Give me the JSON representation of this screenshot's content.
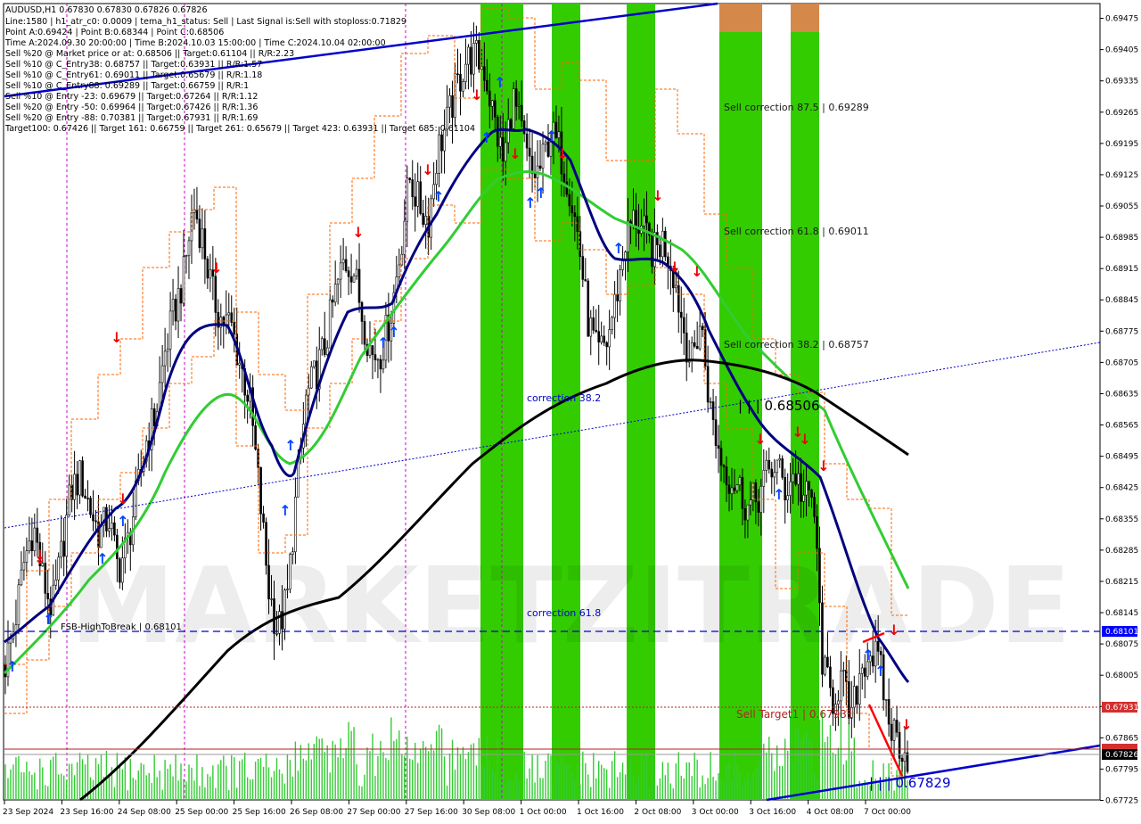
{
  "header": {
    "symbol_line": "AUDUSD,H1  0.67830 0.67830 0.67826 0.67826",
    "info_lines": [
      "Line:1580 | h1_atr_c0: 0.0009 | tema_h1_status: Sell | Last Signal is:Sell with stoploss:0.71829",
      "Point A:0.69424 | Point B:0.68344 | Point C:0.68506",
      "Time A:2024.09.30 20:00:00 | Time B:2024.10.03 15:00:00 | Time C:2024.10.04 02:00:00",
      "Sell %20 @ Market price or at: 0.68506 || Target:0.61104 || R/R:2.23",
      "Sell %10 @ C_Entry38: 0.68757 || Target:0.63931 || R/R:1.57",
      "Sell %10 @ C_Entry61: 0.69011 || Target:0.65679 || R/R:1.18",
      "Sell %10 @ C_Entry88: 0.69289 || Target:0.66759 || R/R:1",
      "Sell %10 @ Entry -23: 0.69679 || Target:0.67264 || R/R:1.12",
      "Sell %20 @ Entry -50: 0.69964 || Target:0.67426 || R/R:1.36",
      "Sell %20 @ Entry -88: 0.70381 || Target:0.67931 || R/R:1.69",
      "Target100: 0.67426 || Target 161: 0.66759 || Target 261: 0.65679 || Target 423: 0.63931 || Target 685: 0.61104"
    ]
  },
  "annotations": {
    "sell_correction_875": "Sell correction 87.5 | 0.69289",
    "sell_correction_618": "Sell correction 61.8 | 0.69011",
    "sell_correction_382": "Sell correction 38.2 | 0.68757",
    "correction_382": "correction 38.2",
    "correction_618": "correction 61.8",
    "point_c_label": "| | | 0.68506",
    "fsb_label": "FSB-HighToBreak | 0.68101",
    "sell_target_label": "Sell Target1 | 0.67931",
    "low_label": "| | | 0.67829",
    "watermark": "MARKETZITRADE"
  },
  "price_tags": {
    "fsb": "0.68101",
    "target1": "0.67931",
    "current": "0.67826",
    "hidden": "0.67837"
  },
  "colors": {
    "blue_line": "#0000cc",
    "tag_blue": "#0000ff",
    "tag_red": "#d32f2f",
    "green_zone": "#33cc00",
    "orange_zone": "#d4884a",
    "ma_green": "#33cc33",
    "ma_navy": "#000080",
    "ma_black": "#000000",
    "envelope": "#ff6600",
    "candle": "#000000",
    "volume": "#33cc33"
  },
  "chart_data": {
    "type": "candlestick",
    "symbol": "AUDUSD",
    "timeframe": "H1",
    "ylim": [
      0.67726,
      0.69508
    ],
    "grid": false,
    "y_ticks": [
      "0.69475",
      "0.69405",
      "0.69335",
      "0.69265",
      "0.69195",
      "0.69125",
      "0.69055",
      "0.68985",
      "0.68915",
      "0.68845",
      "0.68775",
      "0.68705",
      "0.68635",
      "0.68565",
      "0.68495",
      "0.68425",
      "0.68355",
      "0.68285",
      "0.68215",
      "0.68145",
      "0.68075",
      "0.68005",
      "0.67935",
      "0.67865",
      "0.67795",
      "0.67725"
    ],
    "x_ticks": [
      "23 Sep 2024",
      "23 Sep 16:00",
      "24 Sep 08:00",
      "25 Sep 00:00",
      "25 Sep 16:00",
      "26 Sep 08:00",
      "27 Sep 00:00",
      "27 Sep 16:00",
      "30 Sep 08:00",
      "1 Oct 00:00",
      "1 Oct 16:00",
      "2 Oct 08:00",
      "3 Oct 00:00",
      "3 Oct 16:00",
      "4 Oct 08:00",
      "7 Oct 00:00"
    ],
    "levels": [
      {
        "name": "FSB-HighToBreak",
        "value": 0.68101
      },
      {
        "name": "Sell Target1",
        "value": 0.67931
      },
      {
        "name": "Current price",
        "value": 0.67826
      }
    ],
    "close_path": [
      0.6803,
      0.6812,
      0.6826,
      0.6834,
      0.6822,
      0.6815,
      0.6828,
      0.6842,
      0.6845,
      0.6838,
      0.6832,
      0.6836,
      0.6824,
      0.683,
      0.6841,
      0.6853,
      0.6859,
      0.6873,
      0.6882,
      0.689,
      0.6906,
      0.6898,
      0.6886,
      0.688,
      0.6879,
      0.687,
      0.6862,
      0.6842,
      0.682,
      0.681,
      0.6818,
      0.6842,
      0.6862,
      0.6868,
      0.6874,
      0.6885,
      0.6893,
      0.6892,
      0.6881,
      0.6872,
      0.6873,
      0.6881,
      0.6895,
      0.6912,
      0.6906,
      0.6902,
      0.6918,
      0.6924,
      0.6932,
      0.6938,
      0.6939,
      0.6936,
      0.6925,
      0.6915,
      0.693,
      0.6921,
      0.6912,
      0.6914,
      0.6922,
      0.6918,
      0.691,
      0.6898,
      0.688,
      0.6872,
      0.6875,
      0.6885,
      0.6898,
      0.6903,
      0.6899,
      0.6895,
      0.6898,
      0.6892,
      0.688,
      0.687,
      0.688,
      0.686,
      0.685,
      0.6845,
      0.6843,
      0.6838,
      0.684,
      0.6845,
      0.6848,
      0.6842,
      0.6846,
      0.684,
      0.684,
      0.6802,
      0.6795,
      0.68,
      0.679,
      0.6802,
      0.6806,
      0.6803,
      0.679,
      0.6786,
      0.67826
    ]
  }
}
